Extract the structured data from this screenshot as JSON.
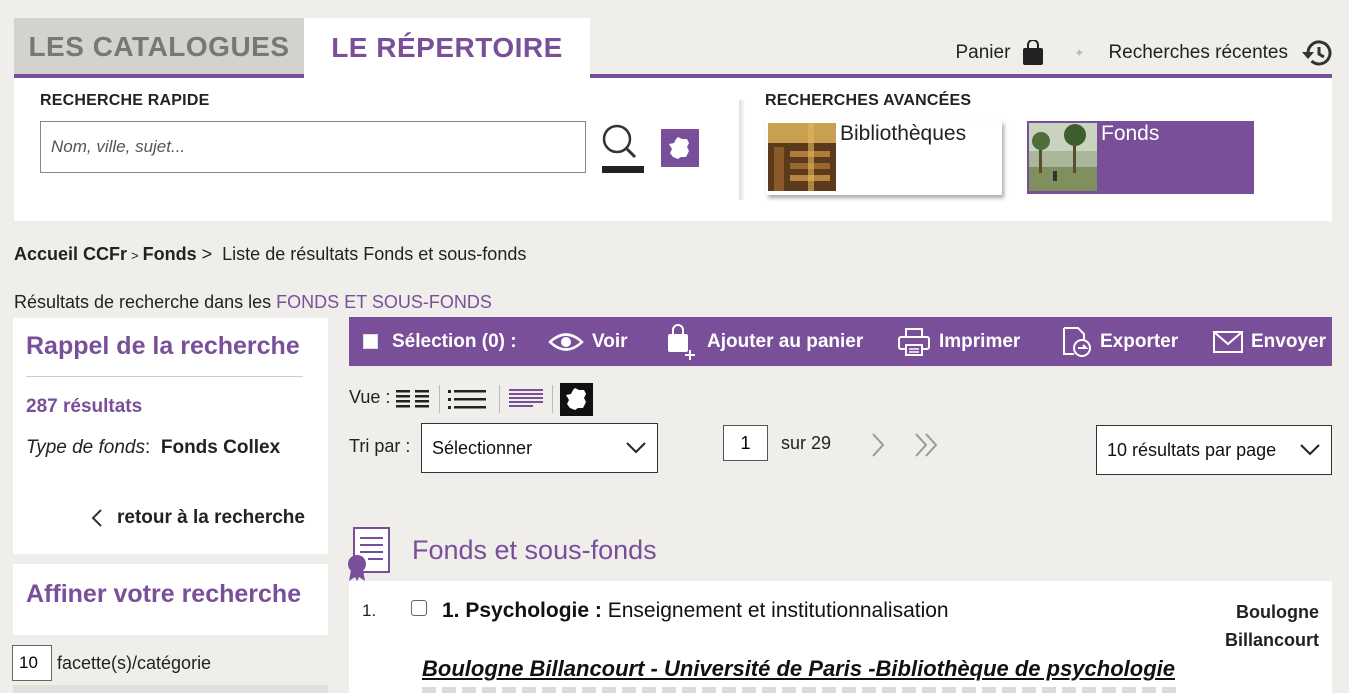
{
  "tabs": {
    "catalogues": "LES CATALOGUES",
    "repertoire": "LE RÉPERTOIRE"
  },
  "top_links": {
    "panier": "Panier",
    "recentes": "Recherches récentes"
  },
  "search": {
    "quick_label": "RECHERCHE RAPIDE",
    "placeholder": "Nom, ville, sujet...",
    "advanced_label": "RECHERCHES AVANCÉES",
    "card_biblio": "Bibliothèques",
    "card_fonds": "Fonds"
  },
  "breadcrumb": {
    "home": "Accueil CCFr",
    "sep1": ">",
    "fonds": "Fonds",
    "sep2": ">",
    "current": "Liste de résultats Fonds et sous-fonds"
  },
  "results_in": {
    "prefix": "Résultats de recherche dans les",
    "scope": "FONDS ET SOUS-FONDS"
  },
  "rappel": {
    "title": "Rappel de la recherche",
    "count": "287 résultats",
    "type_label": "Type de fonds",
    "type_colon": ":",
    "type_value": "Fonds Collex",
    "back": "retour à  la recherche"
  },
  "affiner": {
    "title": "Affiner votre recherche",
    "facet_value": "10",
    "facet_label": "facette(s)/catégorie"
  },
  "toolbar": {
    "selection": "Sélection (0) :",
    "voir": "Voir",
    "panier": "Ajouter au panier",
    "imprimer": "Imprimer",
    "exporter": "Exporter",
    "envoyer": "Envoyer"
  },
  "view": {
    "label": "Vue :"
  },
  "sort": {
    "label": "Tri par :",
    "selected": "Sélectionner"
  },
  "pager": {
    "current": "1",
    "total": "sur 29"
  },
  "per_page": {
    "selected": "10 résultats par page"
  },
  "results": {
    "heading": "Fonds et sous-fonds",
    "items": [
      {
        "num": "1.",
        "title_bold": "1. Psychologie :",
        "title_rest": " Enseignement et institutionnalisation",
        "city_line1": "Boulogne",
        "city_line2": "Billancourt",
        "library": "Boulogne Billancourt - Université de Paris -Bibliothèque de psychologie"
      }
    ]
  },
  "colors": {
    "accent": "#7a4f9a",
    "background": "#efeeea",
    "tab_inactive": "#d4d2cc"
  },
  "icons": {
    "panier": "shopping-bag-icon",
    "recentes": "history-icon",
    "search": "magnifier-icon",
    "map": "france-map-icon",
    "voir": "eye-icon",
    "panier_add": "bag-plus-icon",
    "imprimer": "printer-icon",
    "exporter": "export-icon",
    "envoyer": "envelope-icon",
    "fonds": "certificate-icon"
  }
}
